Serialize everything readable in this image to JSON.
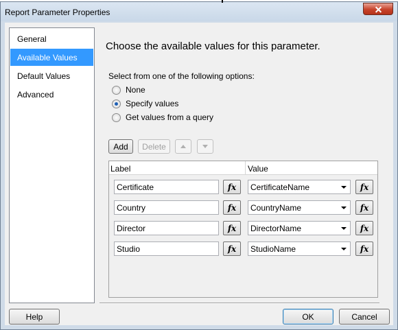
{
  "window": {
    "title": "Report Parameter Properties"
  },
  "nav": {
    "items": [
      {
        "label": "General",
        "selected": false
      },
      {
        "label": "Available Values",
        "selected": true
      },
      {
        "label": "Default Values",
        "selected": false
      },
      {
        "label": "Advanced",
        "selected": false
      }
    ]
  },
  "main": {
    "heading": "Choose the available values for this parameter.",
    "options_label": "Select from one of the following options:",
    "options": [
      {
        "label": "None",
        "checked": false
      },
      {
        "label": "Specify values",
        "checked": true
      },
      {
        "label": "Get values from a query",
        "checked": false
      }
    ]
  },
  "toolbar": {
    "add_label": "Add",
    "delete_label": "Delete"
  },
  "grid": {
    "label_header": "Label",
    "value_header": "Value",
    "fx_glyph": "fx",
    "rows": [
      {
        "label": "Certificate",
        "value": "CertificateName"
      },
      {
        "label": "Country",
        "value": "CountryName"
      },
      {
        "label": "Director",
        "value": "DirectorName"
      },
      {
        "label": "Studio",
        "value": "StudioName"
      }
    ]
  },
  "footer": {
    "help_label": "Help",
    "ok_label": "OK",
    "cancel_label": "Cancel"
  }
}
